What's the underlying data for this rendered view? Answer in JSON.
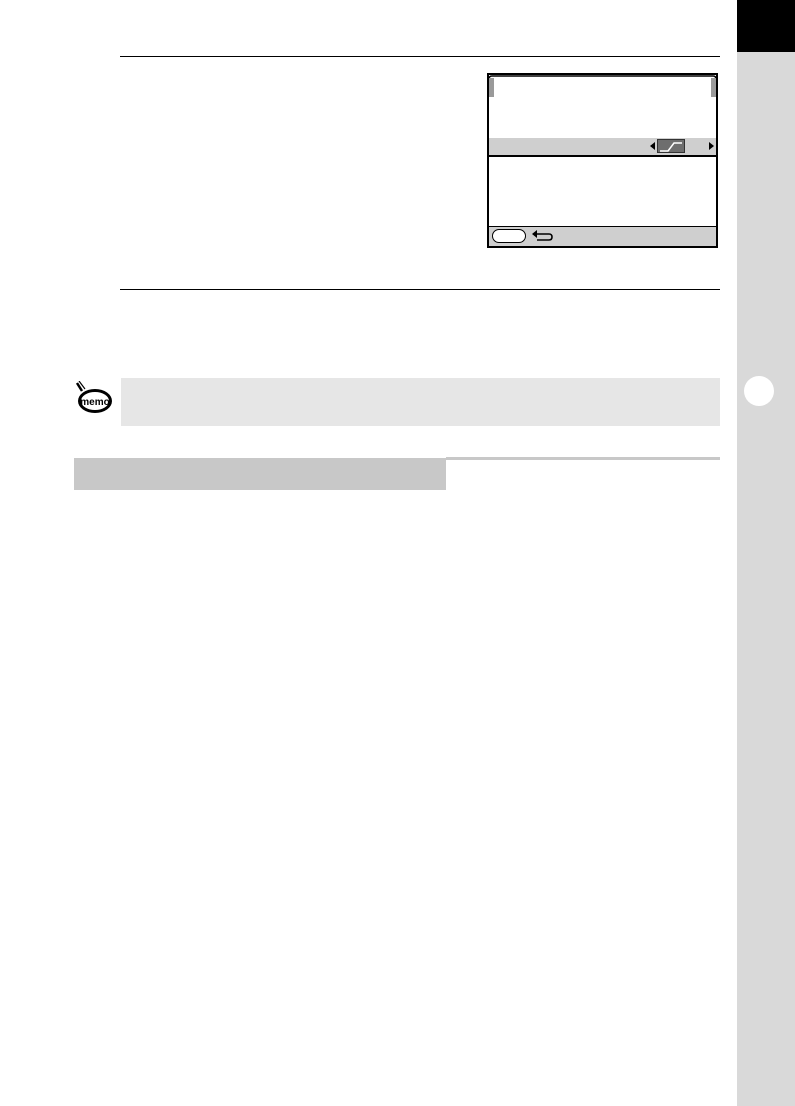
{
  "page": {
    "chapter_tab_color": "#000000",
    "sidebar_color": "#d9d9d9"
  },
  "screen": {
    "description_icons": [
      "arrow-left-icon",
      "contrast-curve-icon",
      "arrow-right-icon",
      "back-icon"
    ]
  },
  "memo": {
    "icon_label": "memo"
  },
  "colors": {
    "memo_background": "#e6e6e6",
    "section_bar": "#c8c8c8",
    "screen_highlight": "#cfcfcf"
  }
}
